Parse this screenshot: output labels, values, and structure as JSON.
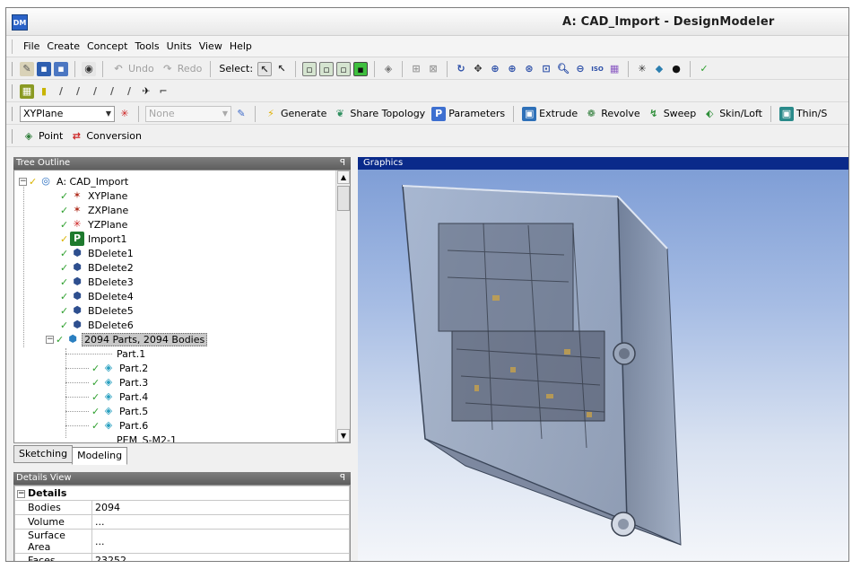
{
  "window": {
    "title": "A: CAD_Import - DesignModeler",
    "logo_text": "DM"
  },
  "menu": [
    "File",
    "Create",
    "Concept",
    "Tools",
    "Units",
    "View",
    "Help"
  ],
  "toolbar1": {
    "undo_label": "Undo",
    "redo_label": "Redo",
    "select_label": "Select:"
  },
  "toolbar3": {
    "plane_value": "XYPlane",
    "sketch_value": "None",
    "generate_label": "Generate",
    "share_topology_label": "Share Topology",
    "parameters_label": "Parameters",
    "extrude_label": "Extrude",
    "revolve_label": "Revolve",
    "sweep_label": "Sweep",
    "skin_loft_label": "Skin/Loft",
    "thin_label": "Thin/S"
  },
  "toolbar4": {
    "point_label": "Point",
    "conversion_label": "Conversion"
  },
  "tree": {
    "header": "Tree Outline",
    "pin": "ꟼ",
    "root": "A: CAD_Import",
    "items": [
      "XYPlane",
      "ZXPlane",
      "YZPlane",
      "Import1",
      "BDelete1",
      "BDelete2",
      "BDelete3",
      "BDelete4",
      "BDelete5",
      "BDelete6"
    ],
    "parts_group": "2094 Parts, 2094 Bodies",
    "parts": [
      "Part.1",
      "Part.2",
      "Part.3",
      "Part.4",
      "Part.5",
      "Part.6",
      "PEM_S-M2-1"
    ]
  },
  "tabs": {
    "sketching": "Sketching",
    "modeling": "Modeling"
  },
  "details": {
    "header": "Details View",
    "group": "Details",
    "rows": [
      {
        "name": "Bodies",
        "value": "2094"
      },
      {
        "name": "Volume",
        "value": "..."
      },
      {
        "name": "Surface Area",
        "value": "..."
      },
      {
        "name": "Faces",
        "value": "23252"
      }
    ]
  },
  "graphics": {
    "header": "Graphics"
  },
  "colors": {
    "graphics_header": "#0a2a8a",
    "check_green": "#2fa02f",
    "panel_header": "#6e6e6e"
  }
}
